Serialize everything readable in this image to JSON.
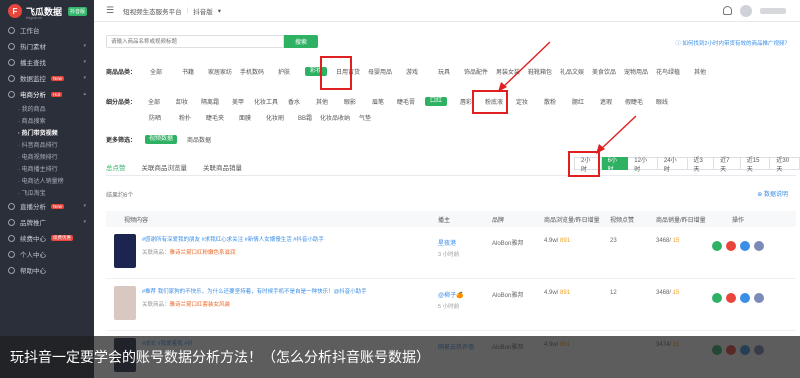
{
  "brand": {
    "name": "飞瓜数据",
    "badge": "抖音版",
    "sub": "feigua.cn"
  },
  "sidebar": {
    "items": [
      {
        "label": "工作台",
        "icon": "home-icon"
      },
      {
        "label": "热门素材",
        "icon": "fire-icon",
        "chev": "▾"
      },
      {
        "label": "播主查找",
        "icon": "user-icon",
        "chev": "▾"
      },
      {
        "label": "数据监控",
        "icon": "monitor-icon",
        "badge": "New",
        "chev": "▾"
      },
      {
        "label": "电商分析",
        "icon": "cart-icon",
        "badge": "Hot",
        "chev": "▴"
      }
    ],
    "subitems": [
      "· 我的商品",
      "· 商品搜索",
      "· 热门带货视频",
      "· 抖音商品排行",
      "· 电商视频排行",
      "· 电商播主排行",
      "· 电商达人销量榜",
      "· 飞瓜淘宝"
    ],
    "bottom": [
      {
        "label": "直播分析",
        "icon": "live-icon",
        "badge": "New",
        "chev": "▾"
      },
      {
        "label": "品牌推广",
        "icon": "brand-icon",
        "chev": "▾"
      },
      {
        "label": "续费中心",
        "icon": "vip-icon",
        "badge": "续费优惠"
      },
      {
        "label": "个人中心",
        "icon": "person-icon"
      },
      {
        "label": "帮助中心",
        "icon": "help-icon"
      }
    ]
  },
  "topbar": {
    "crumb1": "短视频生态服务平台",
    "crumb2": "抖音版",
    "crumb2_chev": "▾"
  },
  "search": {
    "placeholder": "请输入商品名称或视频标题",
    "button": "搜索",
    "help": "ⓘ 如何找到2小时内带货有效的商品推广视频？"
  },
  "filters": {
    "category": {
      "label": "商品品类：",
      "options": [
        "全部",
        "书籍",
        "家居家纺",
        "手机数码",
        "护肤",
        "彩妆",
        "日用百货",
        "母婴用品",
        "游戏",
        "玩具",
        "饰品配件",
        "男装女装",
        "鞋靴箱包",
        "礼品文娱",
        "美食饮品",
        "宠物用品",
        "花鸟绿植",
        "其他"
      ],
      "selected": "彩妆"
    },
    "subcategory": {
      "label": "细分品类：",
      "row1": [
        "全部",
        "卸妆",
        "隔离霜",
        "美甲",
        "化妆工具",
        "香水",
        "其他",
        "眼影",
        "眉笔",
        "睫毛膏",
        "口红",
        "唇彩",
        "粉底液",
        "定妆",
        "散粉",
        "腮红",
        "遮瑕",
        "假睫毛",
        "眼线"
      ],
      "row2": [
        "防晒",
        "粉扑",
        "睫毛夹",
        "面膜",
        "化妆刷",
        "BB霜",
        "化妆品收纳",
        "气垫"
      ],
      "selected": "口红"
    },
    "more": {
      "label": "更多筛选：",
      "options": [
        "视频数据",
        "商品数据"
      ],
      "selected": "视频数据"
    }
  },
  "tabs": [
    "总点赞",
    "关联商品浏览量",
    "关联商品销量"
  ],
  "time_options": [
    "2小时",
    "6小时",
    "12小时",
    "24小时",
    "近3天",
    "近7天",
    "近15天",
    "近30天"
  ],
  "time_selected": "6小时",
  "result_count": "结果约6个",
  "export": "⊕ 数据说明",
  "table": {
    "headers": [
      "视频内容",
      "播主",
      "品牌",
      "商品浏览量/昨日增量",
      "视频点赞",
      "商品销量/昨日增量",
      "操作"
    ],
    "rows": [
      {
        "tags": "#感谢所有深爱我的朋友 #求我红心求关注 #新情人女婿慢生活 #抖音小助手",
        "goods_label": "关联商品：",
        "goods": "雅诗兰黛口红粉嫩色系滋润",
        "author": "星夜港",
        "time": "3 小时前",
        "brand": "AloBon雅邦",
        "views": "4.9w/ 891",
        "likes": "23",
        "sales": "3468/ 15"
      },
      {
        "tags": "#推荐 我们家狗的不快乐，为什么还要坚持着，有时候手机不是自是一种快乐！@抖音小助手",
        "goods_label": "关联商品：",
        "goods": "雅诗兰黛口红套装女风装",
        "author": "@柳子🍊",
        "time": "5 小时前",
        "brand": "AloBon雅邦",
        "views": "4.9w/ 891",
        "likes": "12",
        "sales": "3468/ 15"
      },
      {
        "tags": "#成长 #我爱着我 #抖",
        "goods_label": "",
        "goods": "",
        "author": "网易云热评墙",
        "time": "",
        "brand": "AloBon雅邦",
        "views": "4.9w/ 891",
        "likes": "",
        "sales": "3474/ 15"
      }
    ]
  },
  "caption": "玩抖音一定要学会的账号数据分析方法！（怎么分析抖音账号数据）",
  "colors": {
    "accent": "#2fb164",
    "sidebar": "#2b2f3a",
    "highlight": "#e02020"
  }
}
